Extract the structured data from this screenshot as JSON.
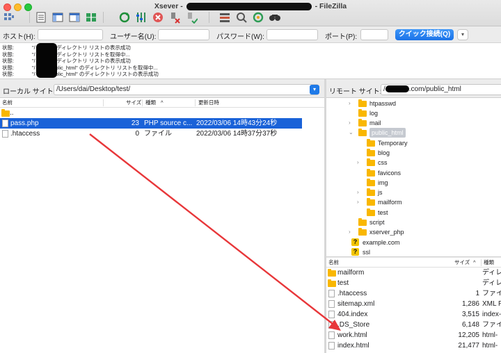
{
  "window": {
    "title_prefix": "Xsever - ",
    "title_suffix": " - FileZilla"
  },
  "toolbar": {
    "icons": [
      "site-manager-icon",
      "toggle-log-icon",
      "toggle-local-tree-icon",
      "toggle-remote-tree-icon",
      "transfer-queue-icon",
      "refresh-icon",
      "process-queue-icon",
      "cancel-icon",
      "disconnect-icon",
      "reconnect-icon",
      "filter-icon",
      "compare-icon",
      "sync-browse-icon",
      "search-icon"
    ]
  },
  "quickconnect": {
    "host_label": "ホスト(H):",
    "host_value": "",
    "user_label": "ユーザー名(U):",
    "user_value": "",
    "pass_label": "パスワード(W):",
    "pass_value": "",
    "port_label": "ポート(P):",
    "port_value": "",
    "connect_label": "クイック接続(Q)",
    "dropdown_glyph": "▾"
  },
  "log": [
    {
      "status": "状態:",
      "message": "\"/          .com\" のディレクトリ リストの表示成功"
    },
    {
      "status": "状態:",
      "message": "\"/          .com\" のディレクトリ リストを取得中..."
    },
    {
      "status": "状態:",
      "message": "\"/          .com\" のディレクトリ リストの表示成功"
    },
    {
      "status": "状態:",
      "message": "\"/          .com/public_html\" のディレクトリ リストを取得中..."
    },
    {
      "status": "状態:",
      "message": "\"/          .com/public_html\" のディレクトリ リストの表示成功"
    }
  ],
  "local": {
    "site_label": "ローカル サイト:",
    "path": "/Users/dai/Desktop/test/",
    "columns": {
      "name": "名前",
      "size": "サイズ",
      "type": "種類",
      "sort_glyph": "^",
      "modified": "更新日時"
    },
    "files": [
      {
        "name": "..",
        "size": "",
        "type": "",
        "modified": "",
        "icon": "folder",
        "selected": false
      },
      {
        "name": "pass.php",
        "size": "23",
        "type": "PHP source c...",
        "modified": "2022/03/06 14時43分24秒",
        "icon": "file",
        "selected": true
      },
      {
        "name": ".htaccess",
        "size": "0",
        "type": "ファイル",
        "modified": "2022/03/06 14時37分37秒",
        "icon": "file",
        "selected": false
      }
    ]
  },
  "remote": {
    "site_label": "リモート サイト:",
    "path_prefix": "/",
    "path_suffix": ".com/public_html",
    "tree": [
      {
        "label": "htpasswd",
        "depth": 1,
        "chevron": ">",
        "icon": "folder"
      },
      {
        "label": "log",
        "depth": 1,
        "chevron": "",
        "icon": "folder"
      },
      {
        "label": "mail",
        "depth": 1,
        "chevron": ">",
        "icon": "folder"
      },
      {
        "label": "public_html",
        "depth": 1,
        "chevron": "v",
        "icon": "folder",
        "highlight": true
      },
      {
        "label": "Temporary",
        "depth": 2,
        "chevron": "",
        "icon": "folder"
      },
      {
        "label": "blog",
        "depth": 2,
        "chevron": "",
        "icon": "folder"
      },
      {
        "label": "css",
        "depth": 2,
        "chevron": ">",
        "icon": "folder"
      },
      {
        "label": "favicons",
        "depth": 2,
        "chevron": "",
        "icon": "folder"
      },
      {
        "label": "img",
        "depth": 2,
        "chevron": "",
        "icon": "folder"
      },
      {
        "label": "js",
        "depth": 2,
        "chevron": ">",
        "icon": "folder"
      },
      {
        "label": "mailform",
        "depth": 2,
        "chevron": ">",
        "icon": "folder"
      },
      {
        "label": "test",
        "depth": 2,
        "chevron": "",
        "icon": "folder"
      },
      {
        "label": "script",
        "depth": 1,
        "chevron": "",
        "icon": "folder"
      },
      {
        "label": "xserver_php",
        "depth": 1,
        "chevron": ">",
        "icon": "folder"
      },
      {
        "label": "example.com",
        "depth": 0,
        "chevron": "",
        "icon": "unknown"
      },
      {
        "label": "ssl",
        "depth": 0,
        "chevron": "",
        "icon": "unknown"
      }
    ],
    "columns": {
      "name": "名前",
      "size": "サイズ",
      "sort_glyph": "^",
      "type": "種類"
    },
    "files": [
      {
        "name": "mailform",
        "size": "",
        "type": "ディレ",
        "icon": "folder"
      },
      {
        "name": "test",
        "size": "",
        "type": "ディレ",
        "icon": "folder"
      },
      {
        "name": ".htaccess",
        "size": "1",
        "type": "ファイ",
        "icon": "file"
      },
      {
        "name": "sitemap.xml",
        "size": "1,286",
        "type": "XML F",
        "icon": "xml"
      },
      {
        "name": "404.index",
        "size": "3,515",
        "type": "index-",
        "icon": "file"
      },
      {
        "name": ".DS_Store",
        "size": "6,148",
        "type": "ファイ",
        "icon": "file"
      },
      {
        "name": "work.html",
        "size": "12,205",
        "type": "html-",
        "icon": "file"
      },
      {
        "name": "index.html",
        "size": "21,477",
        "type": "html-",
        "icon": "file"
      }
    ]
  },
  "colors": {
    "selection": "#1a62d8",
    "accent": "#1f7ae8",
    "arrow": "#e8373a",
    "folder": "#f9b700"
  }
}
